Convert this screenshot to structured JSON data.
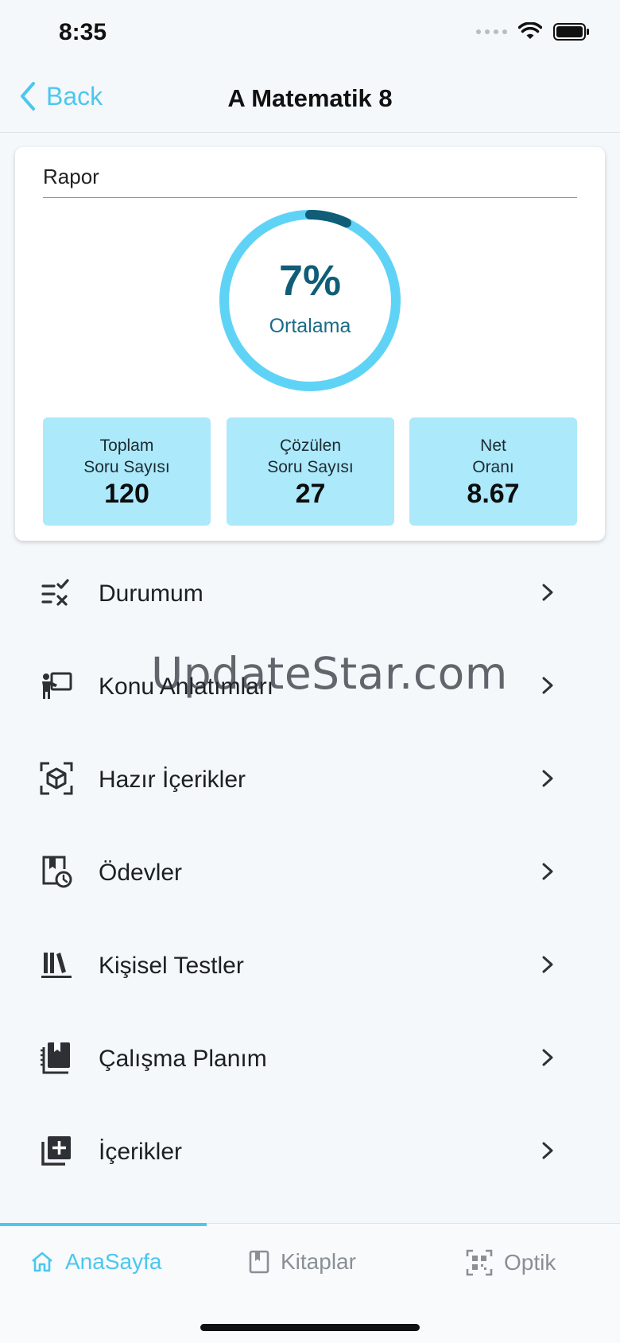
{
  "status_bar": {
    "time": "8:35"
  },
  "nav": {
    "back_label": "Back",
    "title": "A Matematik 8"
  },
  "report": {
    "title": "Rapor",
    "progress_percent": 7,
    "gauge_value": "7%",
    "gauge_label": "Ortalama",
    "stats": [
      {
        "label": "Toplam\nSoru Sayısı",
        "value": "120"
      },
      {
        "label": "Çözülen\nSoru Sayısı",
        "value": "27"
      },
      {
        "label": "Net\nOranı",
        "value": "8.67"
      }
    ]
  },
  "menu": {
    "items": [
      {
        "label": "Durumum",
        "icon": "checklist-icon"
      },
      {
        "label": "Konu Anlatımları",
        "icon": "teacher-board-icon"
      },
      {
        "label": "Hazır İçerikler",
        "icon": "cube-scan-icon"
      },
      {
        "label": "Ödevler",
        "icon": "homework-clock-icon"
      },
      {
        "label": "Kişisel Testler",
        "icon": "library-books-icon"
      },
      {
        "label": "Çalışma Planım",
        "icon": "notebook-icon"
      },
      {
        "label": "İçerikler",
        "icon": "library-add-icon"
      }
    ]
  },
  "watermark": "UpdateStar.com",
  "tabs": [
    {
      "label": "AnaSayfa",
      "icon": "home-icon",
      "active": true
    },
    {
      "label": "Kitaplar",
      "icon": "bookmark-icon",
      "active": false
    },
    {
      "label": "Optik",
      "icon": "qr-scan-icon",
      "active": false
    }
  ],
  "colors": {
    "accent": "#4cc7ee",
    "gauge_track": "#5fd3f6",
    "gauge_progress": "#0f5d77",
    "stat_box": "#abe9fb"
  }
}
